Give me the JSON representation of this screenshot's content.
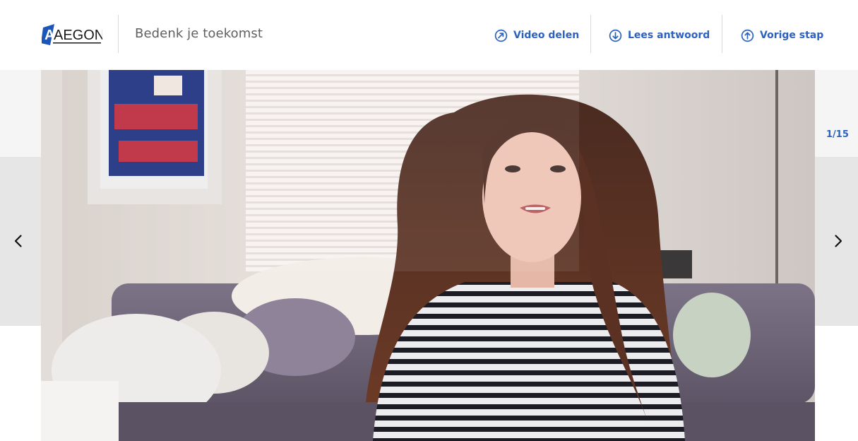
{
  "header": {
    "logo_text": "AEGON",
    "site_title": "Bedenk je toekomst",
    "actions": [
      {
        "label": "Video delen",
        "icon": "share-arrow-icon"
      },
      {
        "label": "Lees antwoord",
        "icon": "arrow-down-circle-icon"
      },
      {
        "label": "Vorige stap",
        "icon": "arrow-up-circle-icon"
      }
    ]
  },
  "slideshow": {
    "counter": "1/15",
    "prev_icon": "chevron-left-icon",
    "next_icon": "chevron-right-icon"
  },
  "colors": {
    "brand_blue": "#2b62c0",
    "logo_blue": "#1d55b9",
    "side_panel": "#e6e6e6",
    "band": "#f5f5f5"
  }
}
